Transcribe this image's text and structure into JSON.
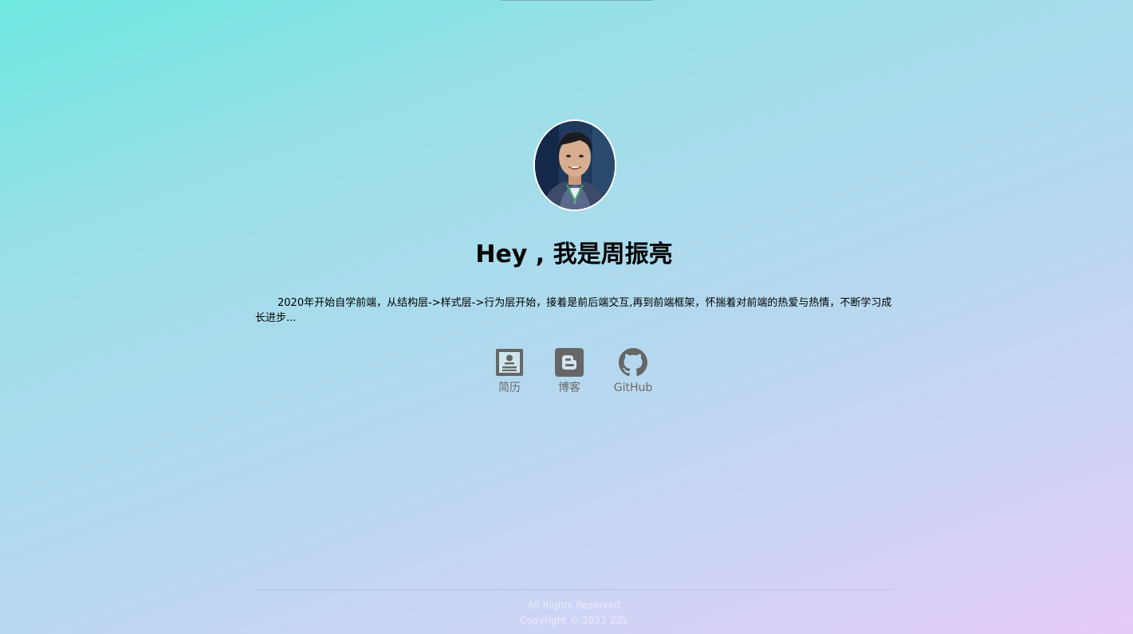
{
  "profile": {
    "avatar_alt": "avatar",
    "title": "Hey , 我是周振亮",
    "intro": "2020年开始自学前端，从结构层->样式层->行为层开始，接着是前后端交互,再到前端框架，怀揣着对前端的热爱与热情，不断学习成长进步..."
  },
  "links": [
    {
      "label": "简历",
      "icon": "resume-icon"
    },
    {
      "label": "博客",
      "icon": "blogger-icon"
    },
    {
      "label": "GitHub",
      "icon": "github-icon"
    }
  ],
  "footer": {
    "rights": "All Rights Reserved",
    "copyright": "Copyright © 2022 ZZL"
  },
  "colors": {
    "icon": "#666666",
    "text": "#000000",
    "gradient_start": "#6ee8e0",
    "gradient_end": "#e6ccf8"
  }
}
